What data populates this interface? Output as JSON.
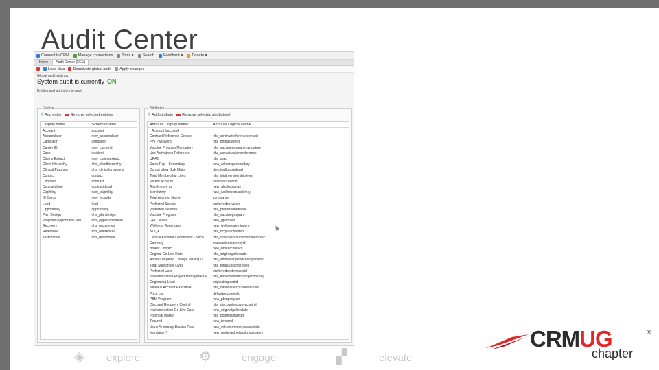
{
  "slide": {
    "title": "Audit Center"
  },
  "app": {
    "toolbar": [
      {
        "label": "Connect to CRM",
        "icon": "connect-icon"
      },
      {
        "label": "Manage connections",
        "icon": "connections-icon"
      },
      {
        "label": "Tools ▾",
        "icon": "tools-icon"
      },
      {
        "label": "Search",
        "icon": "search-icon"
      },
      {
        "label": "Feedback ▾",
        "icon": "feedback-icon"
      },
      {
        "label": "Donate ▾",
        "icon": "donate-icon"
      }
    ],
    "tabs": [
      {
        "label": "Home",
        "active": false
      },
      {
        "label": "Audit Center (DEV)",
        "active": true
      }
    ],
    "actions": [
      {
        "label": "Load data",
        "icon": "load-icon"
      },
      {
        "label": "Deactivate global audit",
        "icon": "deactivate-icon"
      },
      {
        "label": "Apply changes",
        "icon": "apply-icon"
      }
    ],
    "settings_label": "Global audit settings",
    "status_text": "System audit is currently",
    "status_value": "ON",
    "section_label": "Entities and attributes to audit",
    "entities": {
      "caption": "Entities",
      "add_label": "Add entity",
      "remove_label": "Remove selected entities",
      "columns": [
        "Display name",
        "Schema name"
      ],
      "rows": [
        [
          "Account",
          "account"
        ],
        [
          "Accumulator",
          "new_accumulator"
        ],
        [
          "Campaign",
          "campaign"
        ],
        [
          "Carrier ID",
          "new_carrierid"
        ],
        [
          "Case",
          "incident"
        ],
        [
          "Claims Extract",
          "new_claimsextract"
        ],
        [
          "Client Hierarchy",
          "nhs_clienthierarchy"
        ],
        [
          "Clinical Program",
          "nhs_clinicalprograms"
        ],
        [
          "Contact",
          "contact"
        ],
        [
          "Contract",
          "contract"
        ],
        [
          "Contract Line",
          "contractdetail"
        ],
        [
          "Eligibility",
          "new_eligibility"
        ],
        [
          "ID Cards",
          "new_idcards"
        ],
        [
          "Lead",
          "lead"
        ],
        [
          "Opportunity",
          "opportunity"
        ],
        [
          "Plan Design",
          "nhs_plandesign"
        ],
        [
          "Program Opportunity Reli...",
          "nhs_opportunityrelat..."
        ],
        [
          "Recovery",
          "nhs_recoveries"
        ],
        [
          "Reference",
          "nhs_references"
        ],
        [
          "Testimonial",
          "nhs_testimonial"
        ]
      ]
    },
    "attributes": {
      "caption": "Attributes",
      "add_label": "Add attribute",
      "remove_label": "Remove selected attribute(s)",
      "columns": [
        "Attribute Display Name",
        "Attribute Logical Name"
      ],
      "group_label": "Account (account)",
      "rows": [
        [
          "Contract Reference Contact",
          "nhs_contractreferencecontact"
        ],
        [
          "PHI Password",
          "nhs_phipassword"
        ],
        [
          "Vaccine Program Mandatory",
          "nhs_vaccineprogrammandatory"
        ],
        [
          "Use Activations Reference",
          "nhs_useactivationsreference"
        ],
        [
          "URAC",
          "nhs_urac"
        ],
        [
          "Sales Rep - Secondary",
          "new_salesrepsecondary"
        ],
        [
          "Do not allow Bulk Mails",
          "donotbulkpostalmail"
        ],
        [
          "Total Membership Lives",
          "nhs_totalmembershiplives"
        ],
        [
          "Parent Account",
          "parentaccountid"
        ],
        [
          "Also Known as",
          "new_alsoknownas"
        ],
        [
          "Mandatory",
          "new_wellnessmandatory"
        ],
        [
          "Total Accrued Name",
          "yominame"
        ],
        [
          "Preferred Service",
          "preferredserviceid"
        ],
        [
          "Preferred Network",
          "nhs_preferrednetwork"
        ],
        [
          "Vaccine Program",
          "nhs_vaccineprogram"
        ],
        [
          "GPO Notes",
          "new_gponotes"
        ],
        [
          "Wellness Reminders",
          "new_wellnessreminders"
        ],
        [
          "NCQA",
          "nhs_ncqaaccredited"
        ],
        [
          "Clinical Account Coordinator - Seco...",
          "nhs_clinicalaccountcoordinatorsec..."
        ],
        [
          "Currency",
          "transactioncurrencyid"
        ],
        [
          "Broker Contact",
          "new_brokercontact"
        ],
        [
          "Original Go Live Date",
          "nhs_originalgolivedate"
        ],
        [
          "Annual Targeted Change Mailing D...",
          "nhs_annualtargetedchangemailin..."
        ],
        [
          "Total Subscriber Lives",
          "nhs_totalsubscriberlives"
        ],
        [
          "Preferred User",
          "preferredsystemuserid"
        ],
        [
          "Implementation Project Manager/PTA",
          "nhs_implementationprojectmanag..."
        ],
        [
          "Originating Lead",
          "originatingleadid"
        ],
        [
          "National Account Executive",
          "nhs_nationalaccountexecutive"
        ],
        [
          "Price List",
          "defaultpricelevelid"
        ],
        [
          "PBM Program",
          "new_pbmprogram"
        ],
        [
          "Discount Recovery Control",
          "nhs_discountrecoverycontrol"
        ],
        [
          "Implementation Go Live Date",
          "new_originalgolivedate"
        ],
        [
          "Potential Market",
          "nhs_potentialmarket"
        ],
        [
          "Tenured",
          "new_tenured"
        ],
        [
          "Value Summary Review Date",
          "new_valuesummaryreviewdate"
        ],
        [
          "Mandatory?",
          "new_preferrednetworkmandatory"
        ]
      ]
    }
  },
  "footer": {
    "items": [
      {
        "label": "explore",
        "icon": "compass-icon"
      },
      {
        "label": "engage",
        "icon": "gear-icon"
      },
      {
        "label": "elevate",
        "icon": "stairs-icon"
      }
    ]
  },
  "logo": {
    "text_crm": "CRM",
    "text_ug": "UG",
    "reg": "®",
    "sub": "chapter"
  },
  "colors": {
    "accent_red": "#e42525",
    "status_on": "#2aa02a",
    "frame": "#6e6e6e"
  }
}
